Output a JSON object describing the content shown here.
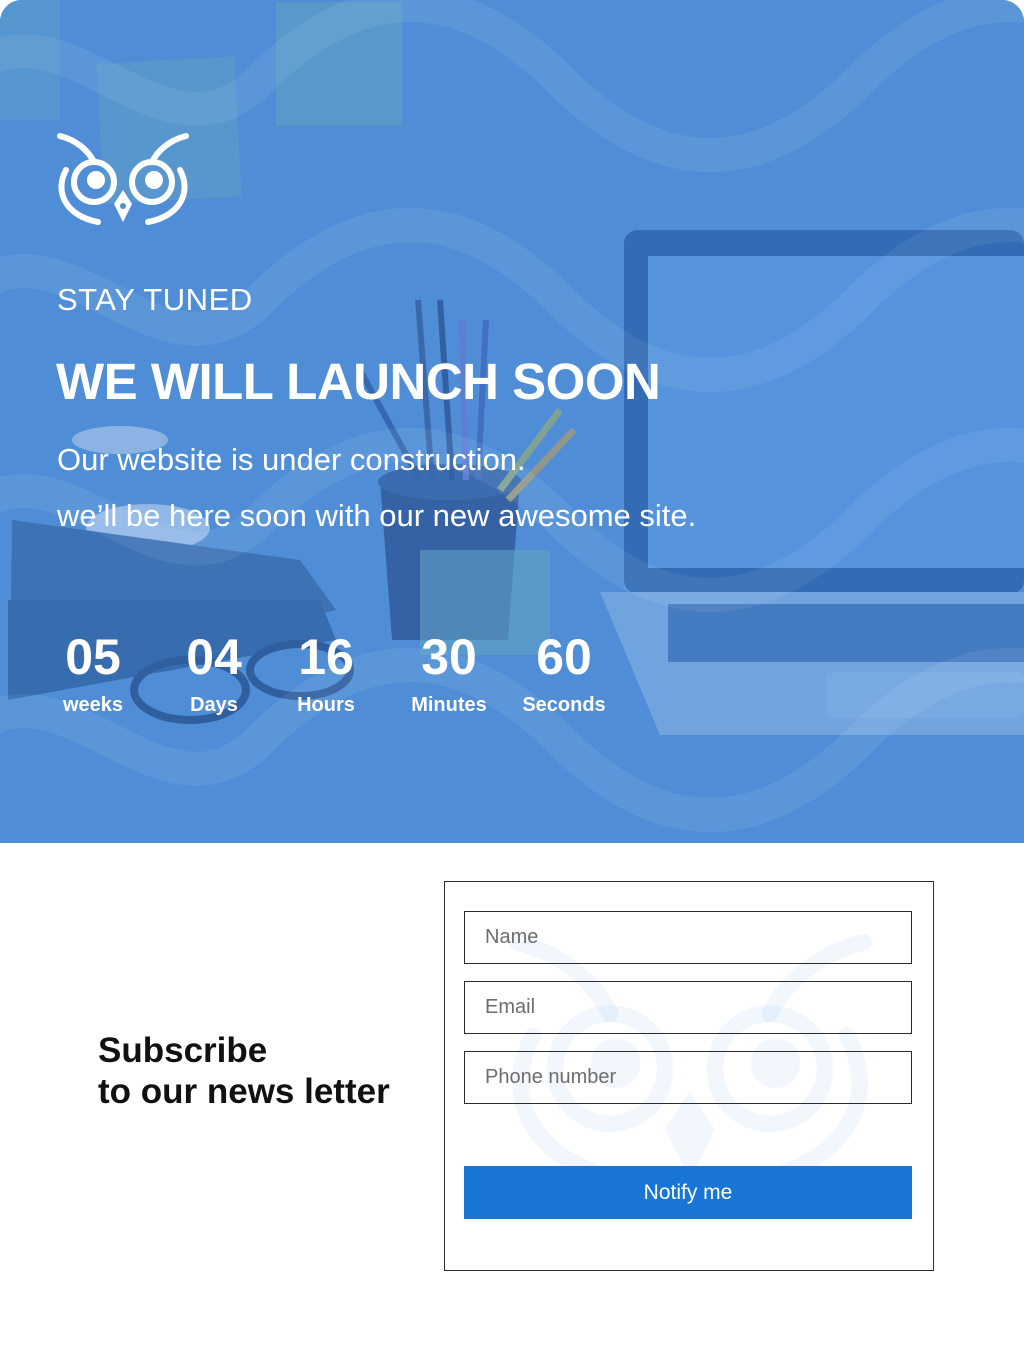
{
  "hero": {
    "kicker": "STAY TUNED",
    "headline": "WE WILL LAUNCH SOON",
    "lead_line_1": "Our website is under construction.",
    "lead_line_2": "we’ll be here soon with our  new awesome site.",
    "logo_icon": "owl-logo-icon",
    "colors": {
      "overlay": "#4f8fd8",
      "text": "#ffffff"
    }
  },
  "countdown": [
    {
      "value": "05",
      "label": "weeks"
    },
    {
      "value": "04",
      "label": "Days"
    },
    {
      "value": "16",
      "label": "Hours"
    },
    {
      "value": "30",
      "label": "Minutes"
    },
    {
      "value": "60",
      "label": "Seconds"
    }
  ],
  "subscribe": {
    "title_line_1": "Subscribe",
    "title_line_2": "to our news letter",
    "fields": {
      "name_placeholder": "Name",
      "email_placeholder": "Email",
      "phone_placeholder": "Phone number"
    },
    "button_label": "Notify me",
    "colors": {
      "button": "#1976d6",
      "border": "#2b2b2b"
    }
  }
}
